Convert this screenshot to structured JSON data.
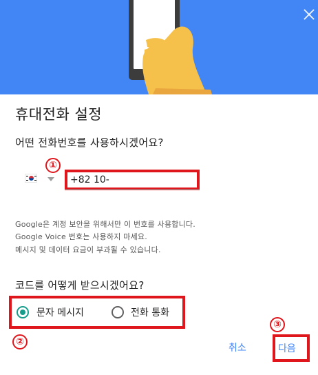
{
  "dialog": {
    "title": "휴대전화 설정",
    "phone_question": "어떤 전화번호를 사용하시겠어요?",
    "country_flag": "korea-flag-icon",
    "phone_value": "+82 10-",
    "notes": [
      "Google은 계정 보안을 위해서만 이 번호를 사용합니다.",
      "Google Voice 번호는 사용하지 마세요.",
      "메시지 및 데이터 요금이 부과될 수 있습니다."
    ],
    "code_question": "코드를 어떻게 받으시겠어요?",
    "options": [
      {
        "label": "문자 메시지",
        "selected": true
      },
      {
        "label": "전화 통화",
        "selected": false
      }
    ],
    "cancel_label": "취소",
    "next_label": "다음"
  },
  "annotations": {
    "marker_1": "①",
    "marker_2": "②",
    "marker_3": "③"
  },
  "colors": {
    "hero": "#4285f4",
    "accent": "#189d8c",
    "link": "#4285f4",
    "highlight": "#e0161d"
  }
}
